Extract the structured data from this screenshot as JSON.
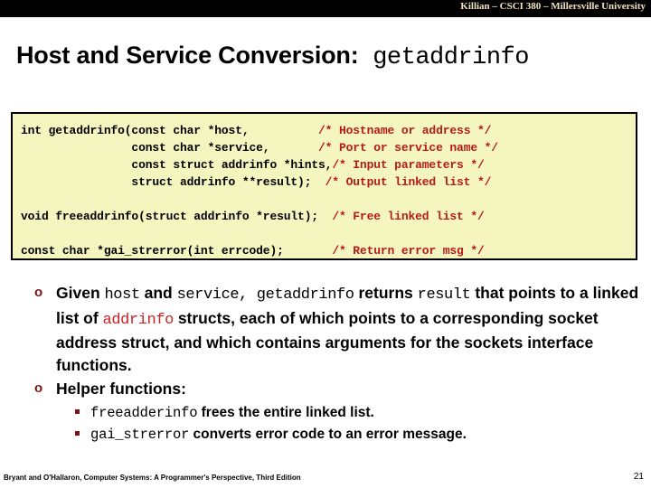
{
  "header": {
    "course_line": "Killian – CSCI 380 – Millersville University",
    "bar_color": "#000000",
    "text_color": "#f2e3c0"
  },
  "title": {
    "prefix": "Host and Service Conversion:",
    "code": " getaddrinfo"
  },
  "code_block": {
    "background": "#f5f5c0",
    "border_color": "#000000",
    "comment_color": "#b51a1a",
    "lines": [
      {
        "code": "int getaddrinfo(const char *host,          ",
        "comment": "/* Hostname or address */"
      },
      {
        "code": "                const char *service,       ",
        "comment": "/* Port or service name */"
      },
      {
        "code": "                const struct addrinfo *hints,",
        "comment": "/* Input parameters */"
      },
      {
        "code": "                struct addrinfo **result);  ",
        "comment": "/* Output linked list */"
      },
      {
        "code": "",
        "comment": ""
      },
      {
        "code": "void freeaddrinfo(struct addrinfo *result);  ",
        "comment": "/* Free linked list */"
      },
      {
        "code": "",
        "comment": ""
      },
      {
        "code": "const char *gai_strerror(int errcode);       ",
        "comment": "/* Return error msg */"
      }
    ]
  },
  "bullets": {
    "marker_color": "#7b1414",
    "level1_marker": "o",
    "main": {
      "seg1": "Given ",
      "code1": "host",
      "seg2": " and ",
      "code2": "service,",
      "code3": " getaddrinfo",
      "seg3": " returns ",
      "code4": "result",
      "seg4": " that points to a linked list of ",
      "code5_red": "addrinfo",
      "seg5": " structs, each of which points to a corresponding socket address struct, and which contains arguments for the sockets interface functions."
    },
    "helper_heading": "Helper functions:",
    "sub_items": [
      {
        "code": "freeadderinfo",
        "text": " frees the entire linked list."
      },
      {
        "code": "gai_strerror",
        "text": " converts error code to an error message."
      }
    ]
  },
  "footer": {
    "source": "Bryant and O'Hallaron, Computer Systems: A Programmer's Perspective, Third Edition",
    "page_number": "21"
  }
}
